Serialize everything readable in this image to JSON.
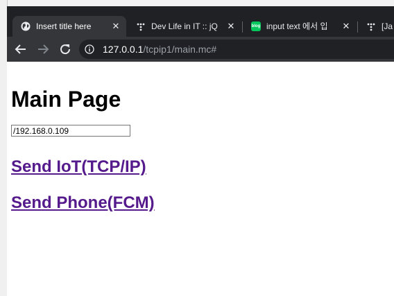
{
  "browser": {
    "tabs": [
      {
        "title": "Insert title here",
        "active": true,
        "favicon": "globe-icon"
      },
      {
        "title": "Dev Life in IT :: jQ",
        "active": false,
        "favicon": "tistory-icon"
      },
      {
        "title": "input text 에서 입",
        "active": false,
        "favicon": "blog-icon",
        "favicon_text": "blog"
      },
      {
        "title": "[Ja",
        "active": false,
        "favicon": "tistory-icon"
      }
    ],
    "close_glyph": "✕",
    "url_host": "127.0.0.1",
    "url_path": "/tcpip1/main.mc#"
  },
  "page": {
    "title": "Main Page",
    "ip_value": "/192.168.0.109",
    "links": [
      "Send IoT(TCP/IP)",
      "Send Phone(FCM)"
    ]
  },
  "colors": {
    "tabbar": "#202124",
    "active_tab": "#35363a",
    "visited_link": "#551a8b",
    "blog_green": "#03c75a"
  }
}
